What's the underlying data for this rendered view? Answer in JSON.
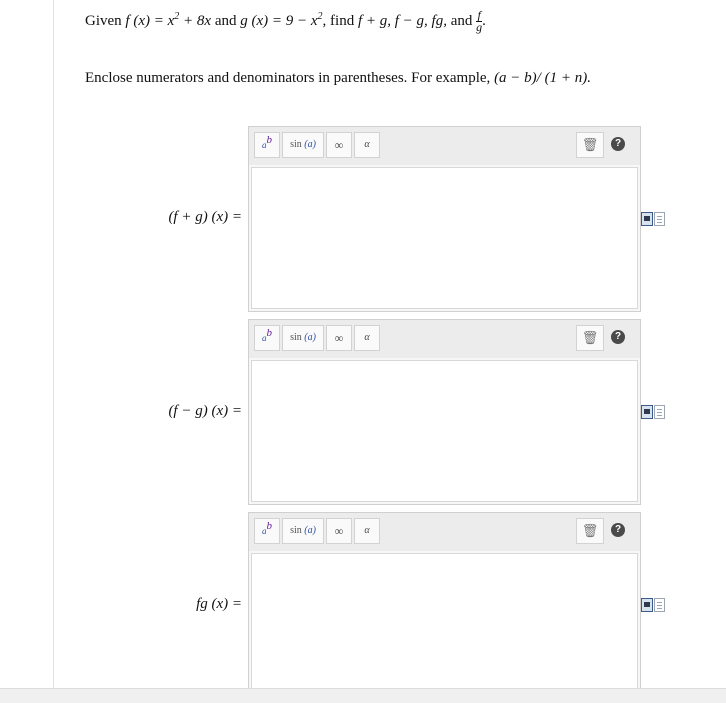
{
  "problem": {
    "given": "Given",
    "f_expr": "f (x) = x",
    "f_exp": "2",
    "f_rest": " + 8x",
    "and1": "and",
    "g_expr": "g (x) = 9 − x",
    "g_exp": "2",
    "find": ", find",
    "ops": "f + g, f − g, fg,",
    "and2": "and",
    "frac_num": "f",
    "frac_den": "g",
    "end": "."
  },
  "instruction": {
    "text": "Enclose numerators and denominators in parentheses. For example,",
    "example": "(a − b)/ (1 + n)."
  },
  "toolbar": {
    "pow_b": "b",
    "pow_a": "a",
    "sin_label": "sin",
    "sin_arg": "(a)",
    "infinity": "∞",
    "alpha": "α",
    "trash_icon": "🗑",
    "help": "?"
  },
  "answers": [
    {
      "label": "(f + g) (x) =",
      "value": ""
    },
    {
      "label": "(f − g) (x) =",
      "value": ""
    },
    {
      "label": "fg (x) =",
      "value": ""
    }
  ]
}
